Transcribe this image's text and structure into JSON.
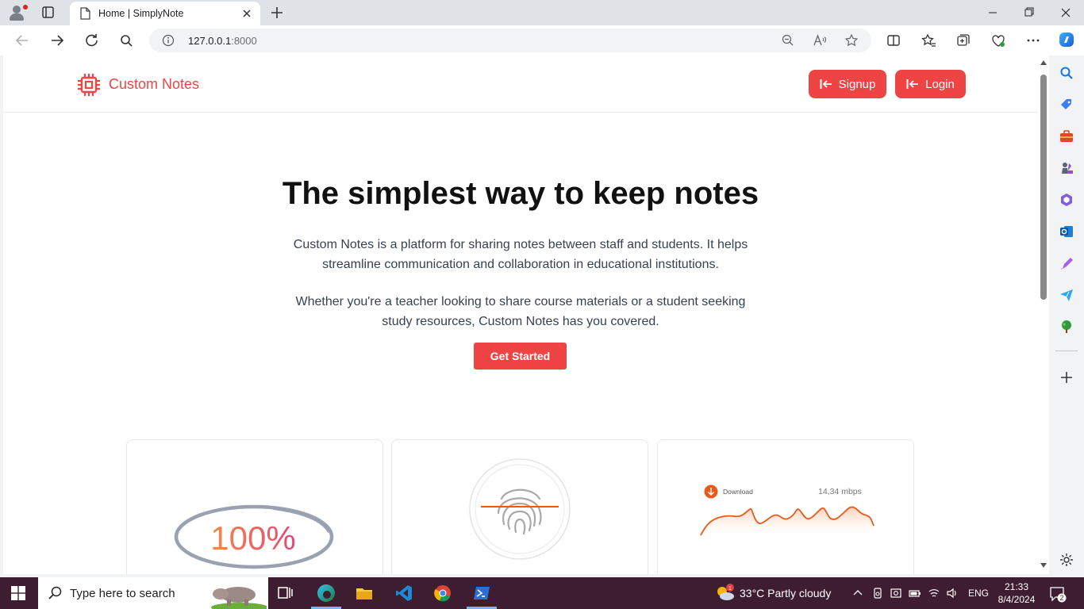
{
  "browser": {
    "tab_title": "Home | SimplyNote",
    "url_host": "127.0.0.1",
    "url_port": ":8000"
  },
  "site": {
    "brand": "Custom Notes",
    "signup_label": "Signup",
    "login_label": "Login",
    "accent": "#ef4444"
  },
  "hero": {
    "title": "The simplest way to keep notes",
    "para1": "Custom Notes is a platform for sharing notes between staff and students. It helps streamline communication and collaboration in educational institutions.",
    "para2": "Whether you're a teacher looking to share course materials or a student seeking study resources, Custom Notes has you covered.",
    "cta": "Get Started"
  },
  "cards": {
    "c1_value": "100%",
    "c3_label": "Download",
    "c3_speed": "14,34 mbps"
  },
  "taskbar": {
    "search_placeholder": "Type here to search",
    "weather": "33°C  Partly cloudy",
    "weather_badge": "1",
    "lang": "ENG",
    "time": "21:33",
    "date": "8/4/2024",
    "notification_count": "2"
  }
}
